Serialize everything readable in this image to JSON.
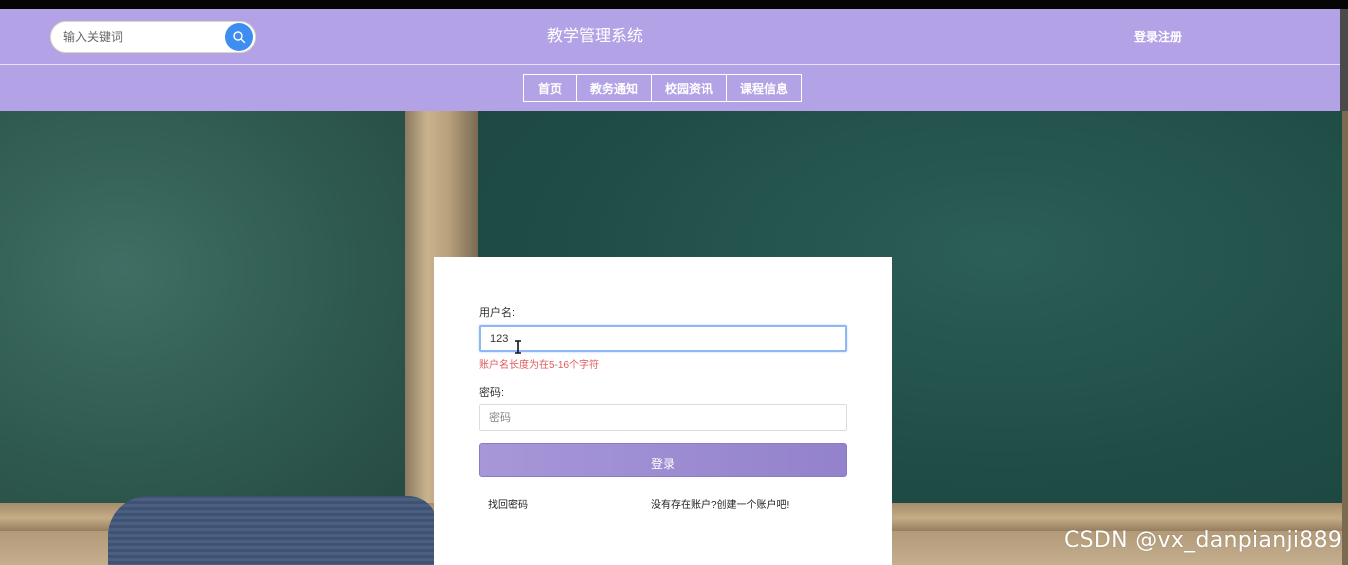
{
  "header": {
    "search_placeholder": "输入关键词",
    "site_title": "教学管理系统",
    "login_register": "登录注册"
  },
  "nav": {
    "items": [
      "首页",
      "教务通知",
      "校园资讯",
      "课程信息"
    ]
  },
  "login_form": {
    "username_label": "用户名:",
    "username_value": "123",
    "username_error": "账户名长度为在5-16个字符",
    "password_label": "密码:",
    "password_placeholder": "密码",
    "login_button": "登录",
    "forgot_password": "找回密码",
    "register_link": "没有存在账户?创建一个账户吧!"
  },
  "watermark": "CSDN @vx_danpianji889",
  "colors": {
    "header_bg": "#b3a3e6",
    "search_button": "#3d8ef0",
    "login_button": "#9a89d0",
    "error_text": "#e05b5b"
  }
}
